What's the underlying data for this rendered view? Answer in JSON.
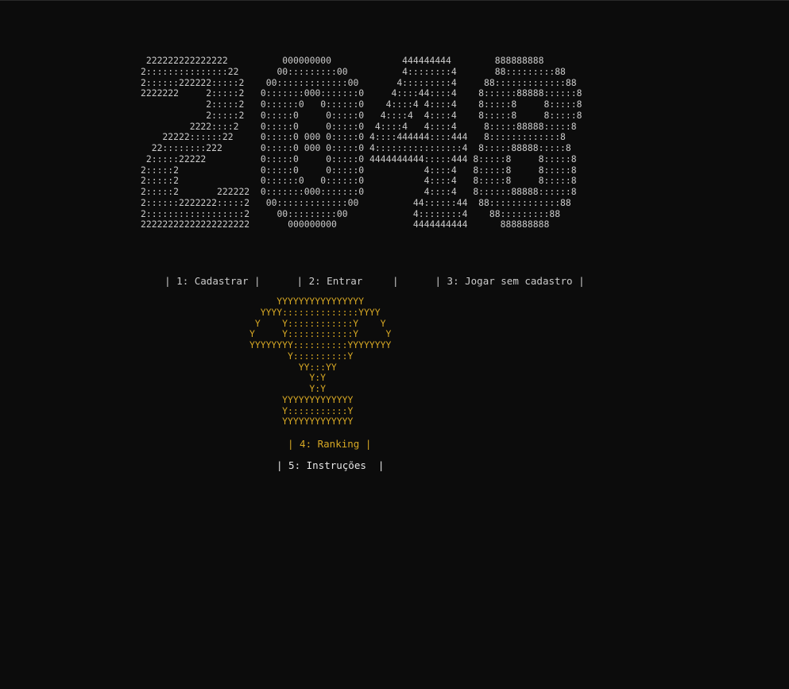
{
  "banner_lines": [
    " 222222222222222          000000000             444444444        888888888",
    "2:::::::::::::::22       00:::::::::00          4::::::::4       88:::::::::88",
    "2::::::222222:::::2    00:::::::::::::00       4:::::::::4     88:::::::::::::88",
    "2222222     2:::::2   0:::::::000:::::::0     4::::44::::4    8::::::88888::::::8",
    "            2:::::2   0::::::0   0::::::0    4::::4 4::::4    8:::::8     8:::::8",
    "            2:::::2   0:::::0     0:::::0   4::::4  4::::4    8:::::8     8:::::8",
    "         2222::::2    0:::::0     0:::::0  4::::4   4::::4     8:::::88888:::::8",
    "    22222::::::22     0:::::0 000 0:::::0 4::::444444::::444   8:::::::::::::8",
    "  22::::::::222       0:::::0 000 0:::::0 4::::::::::::::::4  8:::::88888:::::8",
    " 2:::::22222          0:::::0     0:::::0 4444444444:::::444 8:::::8     8:::::8",
    "2:::::2               0:::::0     0:::::0           4::::4   8:::::8     8:::::8",
    "2:::::2               0::::::0   0::::::0           4::::4   8:::::8     8:::::8",
    "2:::::2       222222  0:::::::000:::::::0           4::::4   8::::::88888::::::8",
    "2::::::2222222:::::2   00:::::::::::::00          44::::::44  88:::::::::::::88",
    "2::::::::::::::::::2     00:::::::::00            4::::::::4    88:::::::::88",
    "22222222222222222222       000000000              4444444444      888888888"
  ],
  "menu": {
    "pipe": "|",
    "cadastrar": " 1: Cadastrar ",
    "entrar": " 2: Entrar     ",
    "jogar": " 3: Jogar sem cadastro "
  },
  "trophy_lines": [
    "     YYYYYYYYYYYYYYYY",
    "  YYYY::::::::::::::YYYY",
    " Y    Y::::::::::::Y    Y",
    "Y     Y::::::::::::Y     Y",
    "YYYYYYYY::::::::::YYYYYYYY",
    "       Y::::::::::Y",
    "         YY:::YY",
    "           Y:Y",
    "           Y:Y",
    "      YYYYYYYYYYYYY",
    "      Y:::::::::::Y",
    "      YYYYYYYYYYYYY"
  ],
  "ranking_label": "| 4: Ranking |",
  "instrucoes_label": "| 5: Instruções  |",
  "colors": {
    "background": "#0c0c0c",
    "text": "#cccccc",
    "gold": "#d7a824",
    "highlight": "#e8e8e8"
  }
}
